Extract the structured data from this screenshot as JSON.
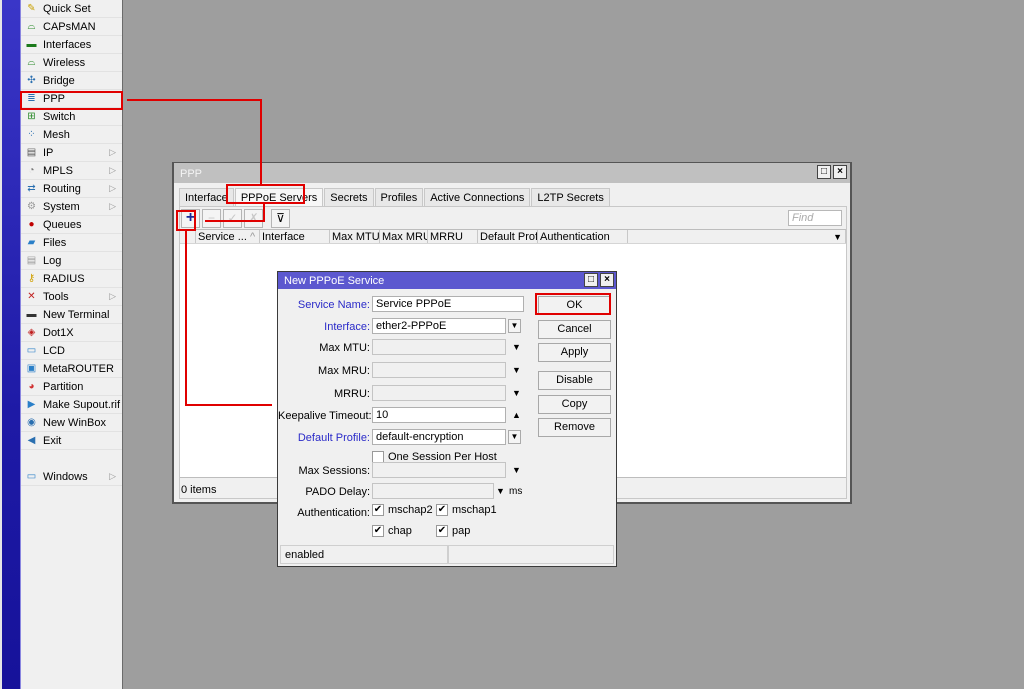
{
  "sidebar": {
    "items": [
      {
        "label": "Quick Set",
        "icon": "wand-icon",
        "glyph": "✎",
        "color": "#c8a000",
        "submenu": false
      },
      {
        "label": "CAPsMAN",
        "icon": "antenna-icon",
        "glyph": "⌓",
        "color": "#2a8a2a",
        "submenu": false
      },
      {
        "label": "Interfaces",
        "icon": "interfaces-icon",
        "glyph": "▬",
        "color": "#1b7a1b",
        "submenu": false
      },
      {
        "label": "Wireless",
        "icon": "wireless-icon",
        "glyph": "⌓",
        "color": "#2a8a2a",
        "submenu": false
      },
      {
        "label": "Bridge",
        "icon": "bridge-icon",
        "glyph": "✣",
        "color": "#2a6fb0",
        "submenu": false
      },
      {
        "label": "PPP",
        "icon": "ppp-icon",
        "glyph": "≣",
        "color": "#2a6fb0",
        "submenu": false
      },
      {
        "label": "Switch",
        "icon": "switch-icon",
        "glyph": "⊞",
        "color": "#2a8a2a",
        "submenu": false
      },
      {
        "label": "Mesh",
        "icon": "mesh-icon",
        "glyph": "⁘",
        "color": "#2a6fb0",
        "submenu": false
      },
      {
        "label": "IP",
        "icon": "ip-icon",
        "glyph": "▤",
        "color": "#555555",
        "submenu": true
      },
      {
        "label": "MPLS",
        "icon": "mpls-icon",
        "glyph": "◔",
        "color": "#777777",
        "submenu": true
      },
      {
        "label": "Routing",
        "icon": "routing-icon",
        "glyph": "⇄",
        "color": "#2a6fb0",
        "submenu": true
      },
      {
        "label": "System",
        "icon": "gear-icon",
        "glyph": "⚙",
        "color": "#999999",
        "submenu": true
      },
      {
        "label": "Queues",
        "icon": "queues-icon",
        "glyph": "●",
        "color": "#c00000",
        "submenu": false
      },
      {
        "label": "Files",
        "icon": "folder-icon",
        "glyph": "▰",
        "color": "#2a7fc8",
        "submenu": false
      },
      {
        "label": "Log",
        "icon": "log-icon",
        "glyph": "▤",
        "color": "#999999",
        "submenu": false
      },
      {
        "label": "RADIUS",
        "icon": "radius-icon",
        "glyph": "⚷",
        "color": "#d0a000",
        "submenu": false
      },
      {
        "label": "Tools",
        "icon": "tools-icon",
        "glyph": "✕",
        "color": "#c02020",
        "submenu": true
      },
      {
        "label": "New Terminal",
        "icon": "terminal-icon",
        "glyph": "▬",
        "color": "#333333",
        "submenu": false
      },
      {
        "label": "Dot1X",
        "icon": "dot1x-icon",
        "glyph": "◈",
        "color": "#c02020",
        "submenu": false
      },
      {
        "label": "LCD",
        "icon": "lcd-icon",
        "glyph": "▭",
        "color": "#2a7fc8",
        "submenu": false
      },
      {
        "label": "MetaROUTER",
        "icon": "metarouter-icon",
        "glyph": "▣",
        "color": "#2a7fc8",
        "submenu": false
      },
      {
        "label": "Partition",
        "icon": "partition-icon",
        "glyph": "◕",
        "color": "#d03030",
        "submenu": false
      },
      {
        "label": "Make Supout.rif",
        "icon": "supout-icon",
        "glyph": "▶",
        "color": "#2a7fc8",
        "submenu": false
      },
      {
        "label": "New WinBox",
        "icon": "winbox-icon",
        "glyph": "◉",
        "color": "#2a6fb0",
        "submenu": false
      },
      {
        "label": "Exit",
        "icon": "exit-icon",
        "glyph": "◀",
        "color": "#2a6fb0",
        "submenu": false
      }
    ],
    "windows": {
      "label": "Windows",
      "icon": "windows-icon",
      "glyph": "▭",
      "color": "#2a7fc8",
      "submenu": true
    }
  },
  "ppp_window": {
    "title": "PPP",
    "tabs": [
      "Interface",
      "PPPoE Servers",
      "Secrets",
      "Profiles",
      "Active Connections",
      "L2TP Secrets"
    ],
    "active_tab": "PPPoE Servers",
    "toolbar": {
      "add": "+",
      "remove": "−",
      "enable": "✓",
      "disable": "✗",
      "filter": "⊽"
    },
    "find_placeholder": "Find",
    "columns": [
      "",
      "Service ...",
      "Interface",
      "Max MTU",
      "Max MRU",
      "MRRU",
      "Default Profile",
      "Authentication",
      ""
    ],
    "sort_indicator": "^",
    "status": "0 items"
  },
  "dialog": {
    "title": "New PPPoE Service",
    "fields": {
      "service_name": {
        "label": "Service Name:",
        "value": "Service PPPoE"
      },
      "interface": {
        "label": "Interface:",
        "value": "ether2-PPPoE"
      },
      "max_mtu": {
        "label": "Max MTU:",
        "value": ""
      },
      "max_mru": {
        "label": "Max MRU:",
        "value": ""
      },
      "mrru": {
        "label": "MRRU:",
        "value": ""
      },
      "keepalive_timeout": {
        "label": "Keepalive Timeout:",
        "value": "10"
      },
      "default_profile": {
        "label": "Default Profile:",
        "value": "default-encryption"
      },
      "one_session": {
        "label": "One Session Per Host",
        "checked": false
      },
      "max_sessions": {
        "label": "Max Sessions:",
        "value": ""
      },
      "pado_delay": {
        "label": "PADO Delay:",
        "value": "",
        "unit": "ms"
      },
      "authentication": {
        "label": "Authentication:"
      }
    },
    "auth_options": [
      {
        "label": "mschap2",
        "checked": true
      },
      {
        "label": "mschap1",
        "checked": true
      },
      {
        "label": "chap",
        "checked": true
      },
      {
        "label": "pap",
        "checked": true
      }
    ],
    "buttons": [
      "OK",
      "Cancel",
      "Apply",
      "Disable",
      "Copy",
      "Remove"
    ],
    "status_left": "enabled",
    "status_right": ""
  },
  "colors": {
    "highlight": "#e00000",
    "dialog_title": "#5c58cf",
    "link_label": "#2a2ac8"
  }
}
